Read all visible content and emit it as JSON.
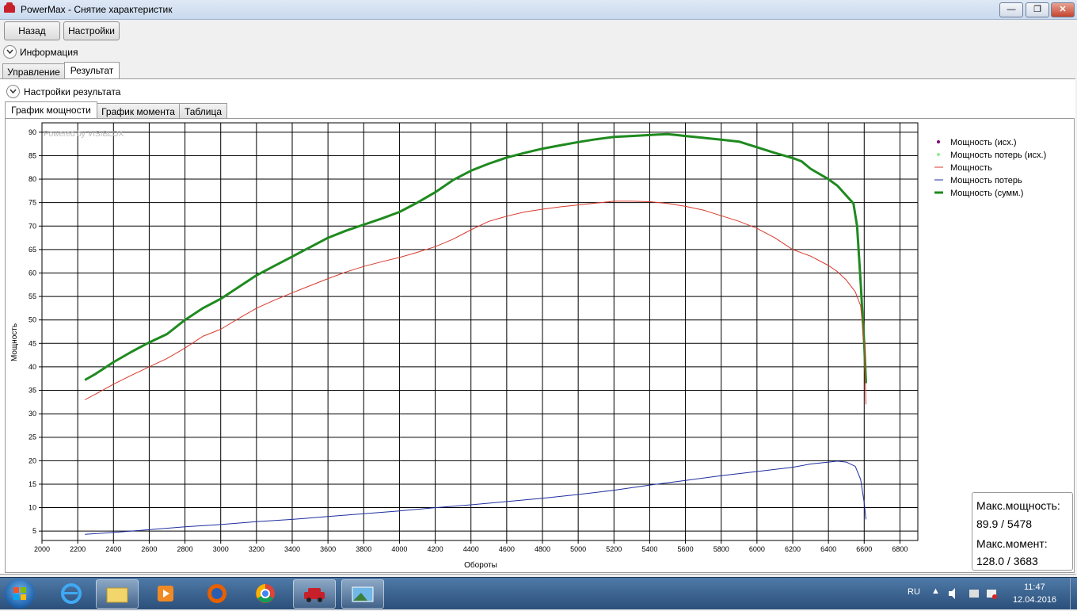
{
  "window": {
    "title": "PowerMax - Снятие характеристик"
  },
  "toolbar": {
    "back_label": "Назад",
    "settings_label": "Настройки"
  },
  "info_section": {
    "label": "Информация"
  },
  "main_tabs": [
    {
      "label": "Управление"
    },
    {
      "label": "Результат"
    }
  ],
  "result_settings": {
    "label": "Настройки результата"
  },
  "chart_tabs": [
    {
      "label": "График мощности"
    },
    {
      "label": "График момента"
    },
    {
      "label": "Таблица"
    }
  ],
  "watermark": "Powered by VISIBLOX",
  "chart_data": {
    "type": "line",
    "xlabel": "Обороты",
    "ylabel": "Мощность",
    "xlim": [
      2000,
      6900
    ],
    "ylim": [
      3,
      92
    ],
    "x_ticks": [
      2000,
      2200,
      2400,
      2600,
      2800,
      3000,
      3200,
      3400,
      3600,
      3800,
      4000,
      4200,
      4400,
      4600,
      4800,
      5000,
      5200,
      5400,
      5600,
      5800,
      6000,
      6200,
      6400,
      6600,
      6800
    ],
    "y_ticks": [
      5,
      10,
      15,
      20,
      25,
      30,
      35,
      40,
      45,
      50,
      55,
      60,
      65,
      70,
      75,
      80,
      85,
      90
    ],
    "grid": true,
    "legend_position": "top-right",
    "legend": [
      {
        "label": "Мощность (исх.)",
        "marker": "dot",
        "color": "#800080"
      },
      {
        "label": "Мощность потерь (исх.)",
        "marker": "dot",
        "color": "#90ee90"
      },
      {
        "label": "Мощность",
        "marker": "line",
        "color": "#d83a2e"
      },
      {
        "label": "Мощность потерь",
        "marker": "line",
        "color": "#1f2ea0"
      },
      {
        "label": "Мощность (сумм.)",
        "marker": "thick-line",
        "color": "#1f8a1f"
      }
    ],
    "series": [
      {
        "name": "Мощность (сумм.)",
        "color": "#1f8a1f",
        "width": 3,
        "x": [
          2240,
          2300,
          2400,
          2500,
          2600,
          2700,
          2800,
          2900,
          3000,
          3100,
          3200,
          3300,
          3400,
          3500,
          3600,
          3700,
          3800,
          3900,
          4000,
          4100,
          4200,
          4300,
          4400,
          4500,
          4600,
          4700,
          4800,
          4900,
          5000,
          5100,
          5200,
          5300,
          5400,
          5450,
          5500,
          5550,
          5600,
          5700,
          5800,
          5900,
          6000,
          6100,
          6200,
          6250,
          6300,
          6400,
          6450,
          6500,
          6540,
          6560,
          6580,
          6600,
          6610
        ],
        "y": [
          37.2,
          38.5,
          41,
          43.2,
          45.2,
          47,
          50,
          52.5,
          54.5,
          57,
          59.5,
          61.5,
          63.5,
          65.5,
          67.5,
          69,
          70.3,
          71.6,
          73,
          75,
          77.2,
          79.8,
          81.8,
          83.3,
          84.6,
          85.6,
          86.5,
          87.2,
          87.9,
          88.5,
          89,
          89.2,
          89.4,
          89.5,
          89.6,
          89.4,
          89.2,
          88.8,
          88.4,
          88,
          86.8,
          85.6,
          84.5,
          83.8,
          82.2,
          80,
          78.6,
          76.5,
          74.8,
          70,
          58,
          45,
          36.5
        ]
      },
      {
        "name": "Мощность",
        "color": "#d83a2e",
        "width": 1,
        "x": [
          2240,
          2300,
          2400,
          2500,
          2600,
          2700,
          2800,
          2900,
          3000,
          3100,
          3200,
          3300,
          3400,
          3500,
          3600,
          3700,
          3800,
          3900,
          4000,
          4100,
          4200,
          4300,
          4400,
          4500,
          4600,
          4700,
          4800,
          4900,
          5000,
          5100,
          5200,
          5300,
          5400,
          5500,
          5600,
          5700,
          5800,
          5900,
          6000,
          6100,
          6200,
          6300,
          6400,
          6450,
          6500,
          6550,
          6580,
          6600,
          6610
        ],
        "y": [
          33,
          34.2,
          36.3,
          38.2,
          40,
          41.8,
          44,
          46.5,
          48,
          50.3,
          52.5,
          54.2,
          55.8,
          57.3,
          58.8,
          60.2,
          61.4,
          62.4,
          63.3,
          64.4,
          65.6,
          67.2,
          69.2,
          71,
          72.1,
          73,
          73.6,
          74.1,
          74.5,
          74.9,
          75.3,
          75.3,
          75.2,
          74.8,
          74.2,
          73.4,
          72.2,
          71,
          69.5,
          67.5,
          65,
          63.6,
          61.6,
          60.3,
          58.5,
          56,
          53,
          45,
          32
        ]
      },
      {
        "name": "Мощность потерь",
        "color": "#1f2ea0",
        "width": 1,
        "x": [
          2240,
          2400,
          2600,
          2800,
          3000,
          3200,
          3400,
          3600,
          3800,
          4000,
          4200,
          4400,
          4600,
          4800,
          5000,
          5200,
          5400,
          5600,
          5800,
          6000,
          6200,
          6300,
          6400,
          6450,
          6500,
          6550,
          6580,
          6600,
          6610
        ],
        "y": [
          4.3,
          4.7,
          5.3,
          5.9,
          6.4,
          7,
          7.5,
          8.1,
          8.7,
          9.3,
          10,
          10.6,
          11.3,
          12,
          12.8,
          13.7,
          14.8,
          15.8,
          16.8,
          17.7,
          18.6,
          19.3,
          19.7,
          19.9,
          19.7,
          18.8,
          16,
          11,
          7.5
        ]
      }
    ]
  },
  "info_box": {
    "max_power_label": "Макс.мощность:",
    "max_power_value": "89.9 / 5478",
    "max_torque_label": "Макс.момент:",
    "max_torque_value": "128.0 / 3683"
  },
  "tray": {
    "language": "RU",
    "time": "11:47",
    "date": "12.04.2016"
  }
}
